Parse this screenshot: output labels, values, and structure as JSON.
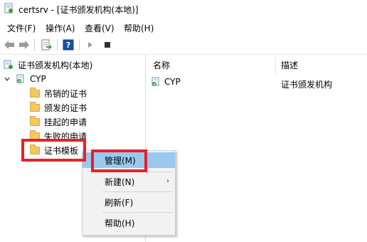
{
  "window": {
    "title": "certsrv - [证书颁发机构(本地)]"
  },
  "menubar": {
    "items": [
      "文件(F)",
      "操作(A)",
      "查看(V)",
      "帮助(H)"
    ]
  },
  "toolbar": {
    "buttons": [
      "back-icon",
      "forward-icon",
      "export-list-icon",
      "help-icon",
      "play-icon",
      "stop-icon"
    ]
  },
  "tree": {
    "root": "证书颁发机构(本地)",
    "ca": "CYP",
    "folders": [
      "吊销的证书",
      "颁发的证书",
      "挂起的申请",
      "失败的申请",
      "证书模板"
    ]
  },
  "list": {
    "columns": [
      "名称",
      "描述"
    ],
    "rows": [
      {
        "name": "CYP",
        "description": "证书颁发机构"
      }
    ]
  },
  "context_menu": {
    "items": [
      "管理(M)",
      "新建(N)",
      "刷新(F)",
      "帮助(H)"
    ],
    "submenu_arrow": "›"
  },
  "colors": {
    "highlight": "#e8202a",
    "menu_hover": "#99c9ef"
  }
}
